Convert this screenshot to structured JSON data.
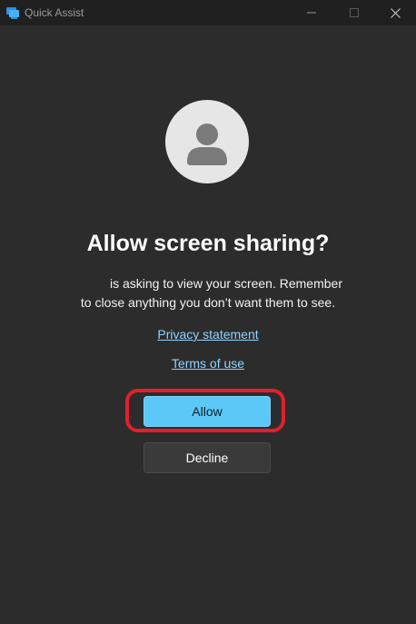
{
  "window": {
    "title": "Quick Assist",
    "minimize_symbol": "—",
    "maximize_symbol": "☐",
    "close_symbol": "✕"
  },
  "dialog": {
    "heading": "Allow screen sharing?",
    "message_part1": "is asking to view your screen. Remember",
    "message_part2": "to close anything you don’t want them to see.",
    "privacy_link": "Privacy statement",
    "terms_link": "Terms of use",
    "allow_label": "Allow",
    "decline_label": "Decline"
  },
  "icons": {
    "app": "quick-assist-icon",
    "avatar": "person-icon"
  },
  "colors": {
    "accent": "#5cc8f7",
    "link": "#8fd3ff",
    "highlight": "#e0202e",
    "background": "#2c2c2c"
  }
}
